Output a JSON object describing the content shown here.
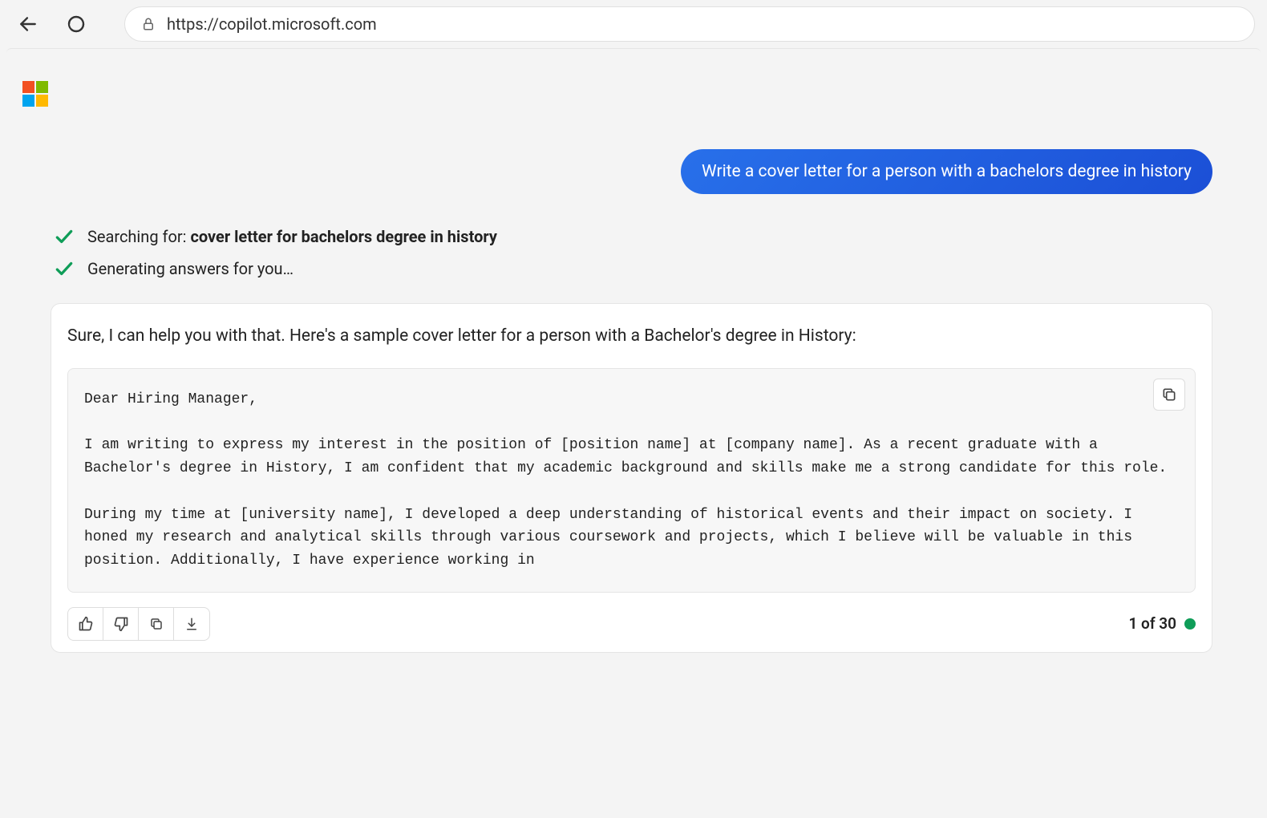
{
  "browser": {
    "url": "https://copilot.microsoft.com"
  },
  "chat": {
    "user_message": "Write a cover letter for a person with a bachelors degree in history",
    "status": {
      "searching_prefix": "Searching for: ",
      "searching_query": "cover letter for bachelors degree in history",
      "generating": "Generating answers for you…"
    },
    "response": {
      "intro": "Sure, I can help you with that. Here's a sample cover letter for a person with a Bachelor's degree in History:",
      "code": "Dear Hiring Manager,\n\nI am writing to express my interest in the position of [position name] at [company name]. As a recent graduate with a Bachelor's degree in History, I am confident that my academic background and skills make me a strong candidate for this role.\n\nDuring my time at [university name], I developed a deep understanding of historical events and their impact on society. I honed my research and analytical skills through various coursework and projects, which I believe will be valuable in this position. Additionally, I have experience working in",
      "pagination": "1 of 30"
    }
  }
}
